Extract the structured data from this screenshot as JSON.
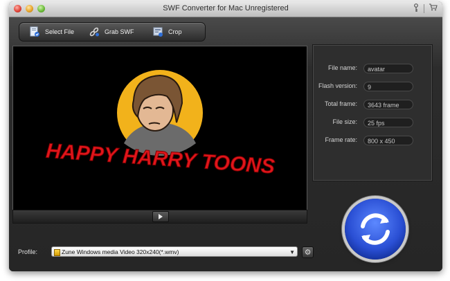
{
  "window": {
    "title": "SWF Converter for Mac Unregistered"
  },
  "titlebar_icons": {
    "key": "key-icon",
    "cart": "cart-icon"
  },
  "toolbar": {
    "select_file": "Select File",
    "grab_swf": "Grab SWF",
    "crop": "Crop"
  },
  "preview": {
    "caption": "HAPPY HARRY TOONS",
    "colors": {
      "logo_circle": "#f2b21b",
      "caption": "#e0151b"
    }
  },
  "info": {
    "rows": [
      {
        "label": "File name:",
        "value": "avatar"
      },
      {
        "label": "Flash version:",
        "value": "9"
      },
      {
        "label": "Total frame:",
        "value": "3643 frame"
      },
      {
        "label": "File size:",
        "value": "25 fps"
      },
      {
        "label": "Frame rate:",
        "value": "800 x 450"
      }
    ]
  },
  "profile": {
    "label": "Profile:",
    "selected": "Zune Windows media Video 320x240(*.wmv)"
  },
  "colors": {
    "accent": "#2a4fd4"
  }
}
